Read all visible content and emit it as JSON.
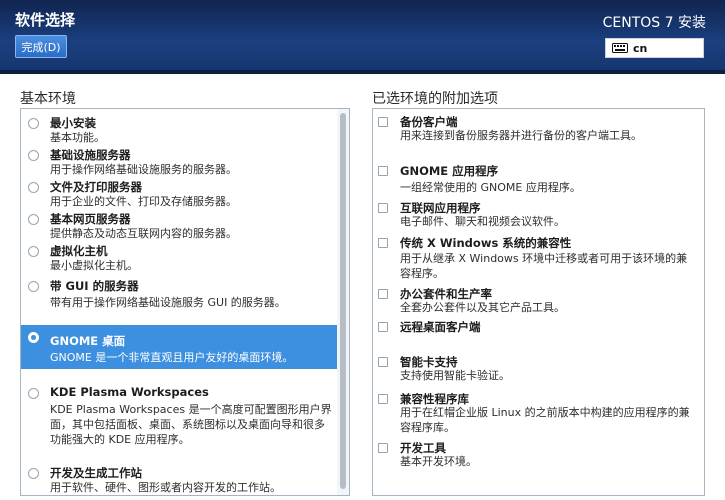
{
  "header": {
    "title": "软件选择",
    "done_label": "完成(D)",
    "product": "CENTOS 7 安装",
    "keyboard_layout": "cn",
    "keyboard_icon": "keyboard-icon"
  },
  "left": {
    "heading": "基本环境",
    "items": [
      {
        "title": "最小安装",
        "desc": "基本功能。",
        "selected": false
      },
      {
        "title": "基础设施服务器",
        "desc": "用于操作网络基础设施服务的服务器。",
        "selected": false
      },
      {
        "title": "文件及打印服务器",
        "desc": "用于企业的文件、打印及存储服务器。",
        "selected": false
      },
      {
        "title": "基本网页服务器",
        "desc": "提供静态及动态互联网内容的服务器。",
        "selected": false
      },
      {
        "title": "虚拟化主机",
        "desc": "最小虚拟化主机。",
        "selected": false
      },
      {
        "title": "带 GUI 的服务器",
        "desc": "带有用于操作网络基础设施服务 GUI 的服务器。",
        "selected": false
      },
      {
        "title": "GNOME 桌面",
        "desc": "GNOME 是一个非常直观且用户友好的桌面环境。",
        "selected": true
      },
      {
        "title": "KDE Plasma Workspaces",
        "desc": "KDE Plasma Workspaces 是一个高度可配置图形用户界面，其中包括面板、桌面、系统图标以及桌面向导和很多功能强大的 KDE 应用程序。",
        "selected": false
      },
      {
        "title": "开发及生成工作站",
        "desc": "用于软件、硬件、图形或者内容开发的工作站。",
        "selected": false
      }
    ]
  },
  "right": {
    "heading": "已选环境的附加选项",
    "items": [
      {
        "title": "备份客户端",
        "desc": "用来连接到备份服务器并进行备份的客户端工具。"
      },
      {
        "title": "GNOME 应用程序",
        "desc": "一组经常使用的 GNOME 应用程序。"
      },
      {
        "title": "互联网应用程序",
        "desc": "电子邮件、聊天和视频会议软件。"
      },
      {
        "title": "传统 X Windows 系统的兼容性",
        "desc": "用于从继承 X Windows 环境中迁移或者可用于该环境的兼容程序。"
      },
      {
        "title": "办公套件和生产率",
        "desc": "全套办公套件以及其它产品工具。"
      },
      {
        "title": "远程桌面客户端",
        "desc": ""
      },
      {
        "title": "智能卡支持",
        "desc": "支持使用智能卡验证。"
      },
      {
        "title": "兼容性程序库",
        "desc": "用于在红帽企业版 Linux 的之前版本中构建的应用程序的兼容程序库。"
      },
      {
        "title": "开发工具",
        "desc": "基本开发环境。"
      }
    ]
  },
  "colors": {
    "header_bg": "#1b3f80",
    "selection": "#3d8fe0",
    "done_button": "#2a6cc6"
  }
}
